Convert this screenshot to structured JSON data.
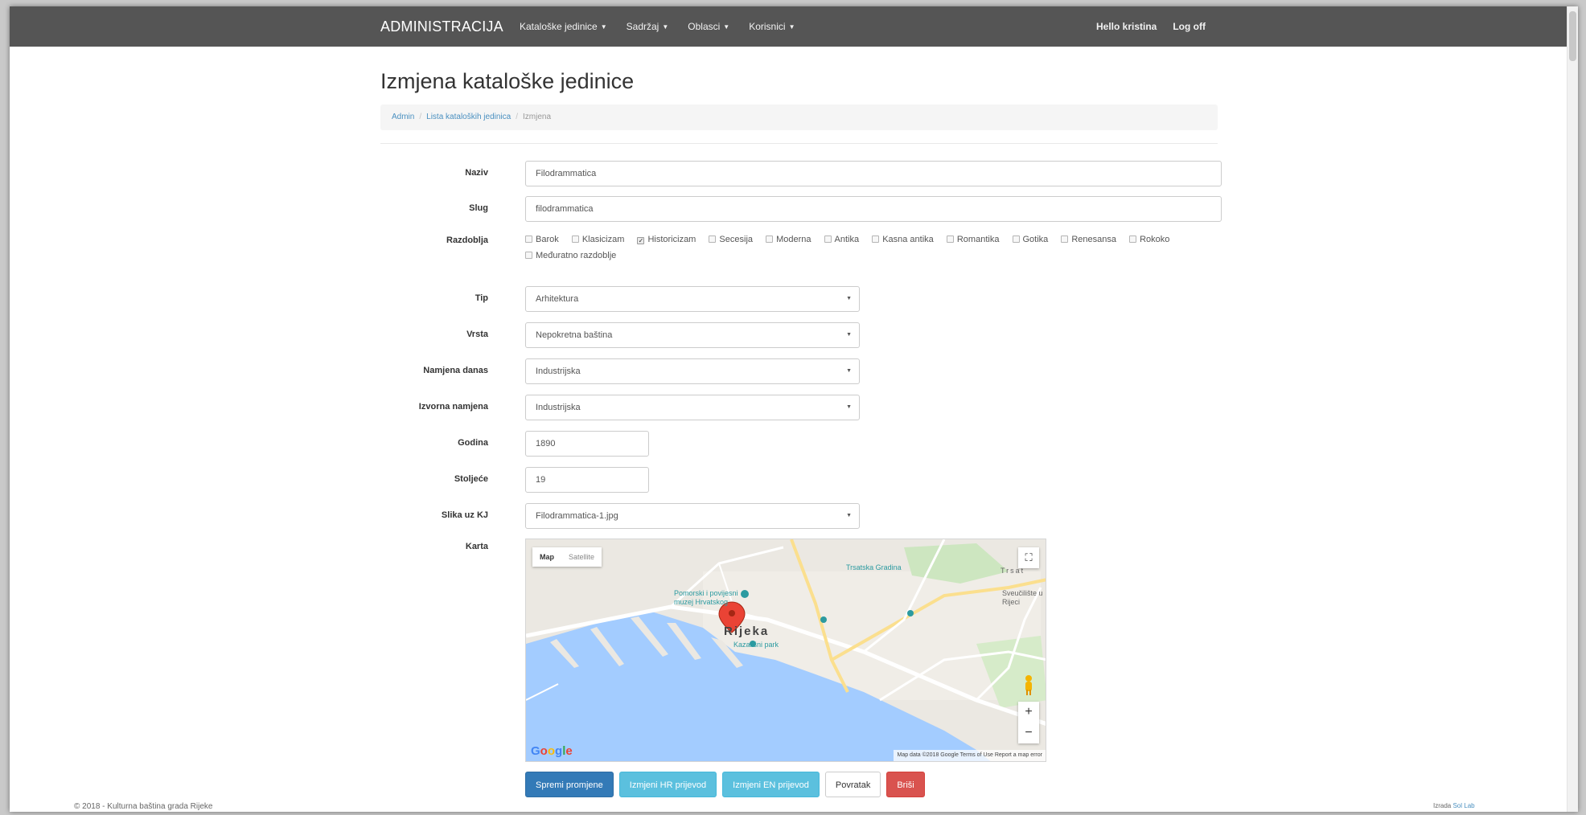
{
  "navbar": {
    "brand": "ADMINISTRACIJA",
    "menu": [
      {
        "label": "Kataloške jedinice"
      },
      {
        "label": "Sadržaj"
      },
      {
        "label": "Oblasci"
      },
      {
        "label": "Korisnici"
      }
    ],
    "greeting": "Hello kristina",
    "logoff": "Log off"
  },
  "page": {
    "title": "Izmjena kataloške jedinice",
    "breadcrumb": [
      "Admin",
      "Lista kataloških jedinica",
      "Izmjena"
    ]
  },
  "form": {
    "naziv": {
      "label": "Naziv",
      "value": "Filodrammatica"
    },
    "slug": {
      "label": "Slug",
      "value": "filodrammatica"
    },
    "razdoblja": {
      "label": "Razdoblja",
      "options": [
        {
          "label": "Barok",
          "checked": false
        },
        {
          "label": "Klasicizam",
          "checked": false
        },
        {
          "label": "Historicizam",
          "checked": true
        },
        {
          "label": "Secesija",
          "checked": false
        },
        {
          "label": "Moderna",
          "checked": false
        },
        {
          "label": "Antika",
          "checked": false
        },
        {
          "label": "Kasna antika",
          "checked": false
        },
        {
          "label": "Romantika",
          "checked": false
        },
        {
          "label": "Gotika",
          "checked": false
        },
        {
          "label": "Renesansa",
          "checked": false
        },
        {
          "label": "Rokoko",
          "checked": false
        },
        {
          "label": "Međuratno razdoblje",
          "checked": false
        }
      ]
    },
    "tip": {
      "label": "Tip",
      "value": "Arhitektura"
    },
    "vrsta": {
      "label": "Vrsta",
      "value": "Nepokretna baština"
    },
    "namjena_danas": {
      "label": "Namjena danas",
      "value": "Industrijska"
    },
    "izvorna_namjena": {
      "label": "Izvorna namjena",
      "value": "Industrijska"
    },
    "godina": {
      "label": "Godina",
      "value": "1890"
    },
    "stoljece": {
      "label": "Stoljeće",
      "value": "19"
    },
    "slika": {
      "label": "Slika uz KJ",
      "value": "Filodrammatica-1.jpg"
    },
    "karta": {
      "label": "Karta"
    }
  },
  "map": {
    "type_map": "Map",
    "type_satellite": "Satellite",
    "city": "Rijeka",
    "labels": {
      "trsat": "Trsat",
      "trsat_castle": "Trsatska Gradina",
      "museum": "Pomorski i povijesni muzej Hrvatskog",
      "park": "Kazališni park",
      "university": "Sveučilište u Rijeci"
    },
    "footer": "Map data ©2018 Google   Terms of Use   Report a map error",
    "logo": "Google"
  },
  "buttons": {
    "save": "Spremi promjene",
    "hr": "Izmjeni HR prijevod",
    "en": "Izmjeni EN prijevod",
    "back": "Povratak",
    "delete": "Briši"
  },
  "footer": {
    "copyright": "© 2018 - Kulturna baština grada Rijeke",
    "credit_prefix": "Izrada",
    "credit_link": "Sol Lab"
  },
  "colors": {
    "navbar": "#555555",
    "primary": "#337ab7",
    "info": "#5bc0de",
    "danger": "#d9534f",
    "sea": "#a3ccff",
    "marker": "#ea4335"
  }
}
